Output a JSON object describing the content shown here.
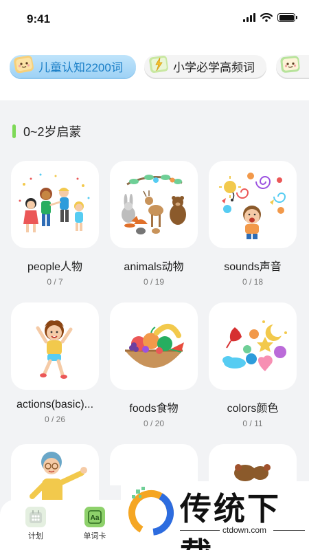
{
  "status_bar": {
    "time": "9:41"
  },
  "tabs": [
    {
      "label": "儿童认知2200词",
      "active": true
    },
    {
      "label": "小学必学高频词",
      "active": false
    },
    {
      "label": "",
      "active": false
    }
  ],
  "section": {
    "title": "0~2岁启蒙"
  },
  "cards": [
    {
      "name": "people人物",
      "count": "0 / 7",
      "icon": "kids-playing-illustration"
    },
    {
      "name": "animals动物",
      "count": "0 / 19",
      "icon": "forest-animals-illustration"
    },
    {
      "name": "sounds声音",
      "count": "0 / 18",
      "icon": "boy-singing-illustration"
    },
    {
      "name": "actions(basic)...",
      "count": "0 / 26",
      "icon": "girl-jumping-illustration"
    },
    {
      "name": "foods食物",
      "count": "0 / 20",
      "icon": "fruit-bowl-illustration"
    },
    {
      "name": "colors颜色",
      "count": "0 / 11",
      "icon": "colorful-shapes-illustration"
    },
    {
      "name": "",
      "count": "",
      "icon": "waving-boy-illustration"
    },
    {
      "name": "",
      "count": "",
      "icon": ""
    },
    {
      "name": "",
      "count": "",
      "icon": ""
    }
  ],
  "bottom_nav": [
    {
      "label": "计划",
      "icon": "calendar-icon"
    },
    {
      "label": "单词卡",
      "icon": "word-card-icon"
    }
  ],
  "watermark": {
    "text": "传统下载",
    "url": "ctdown.com"
  },
  "colors": {
    "accent_blue": "#1b7fc7",
    "section_bar": "#7ed957",
    "background": "#f2f3f5"
  }
}
